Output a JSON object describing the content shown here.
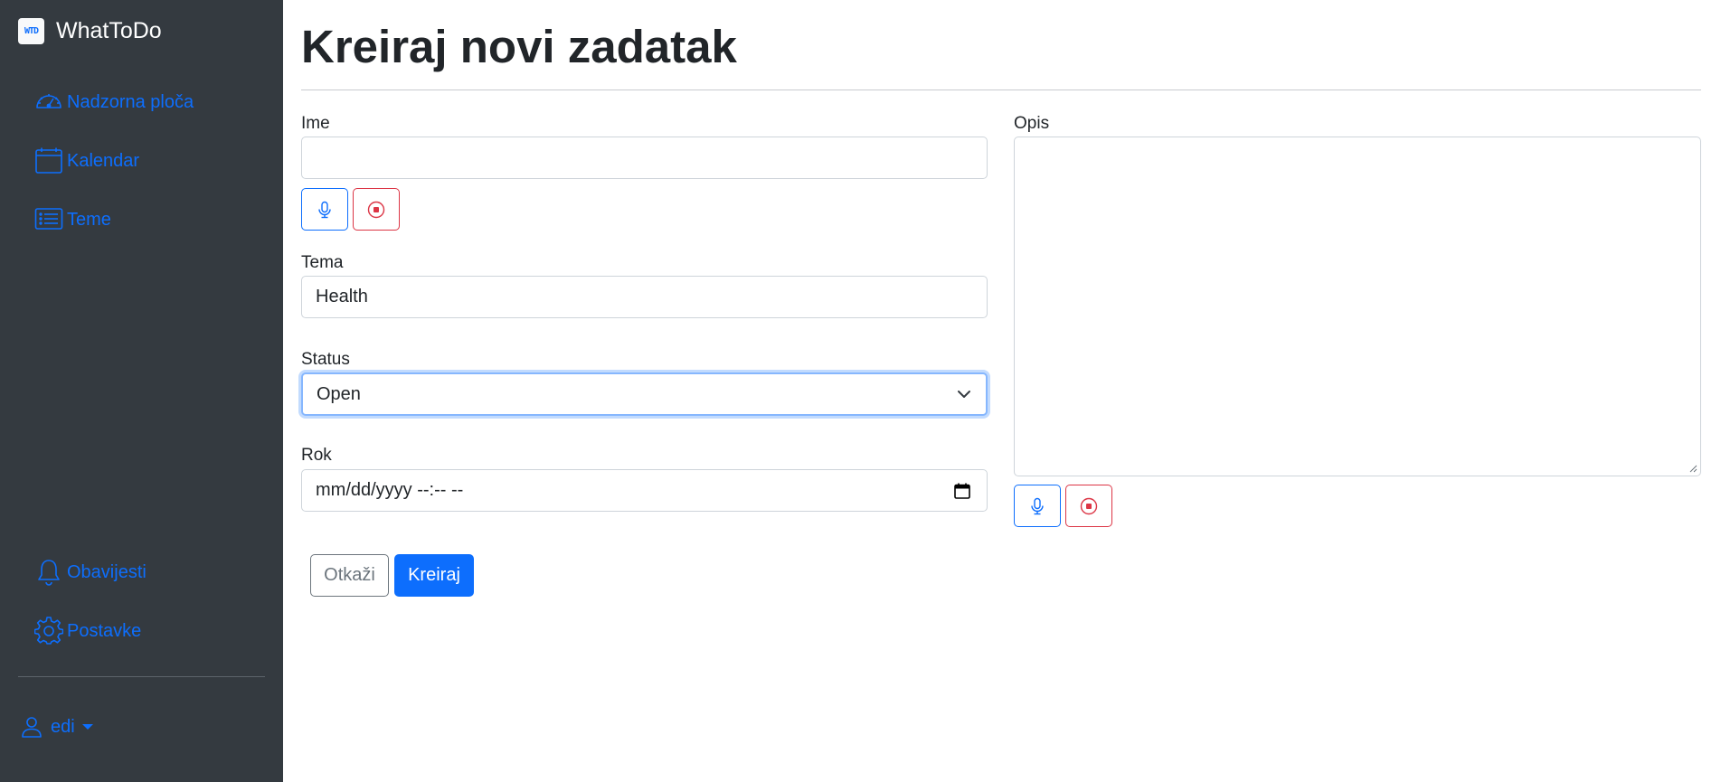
{
  "app": {
    "name": "WhatToDo",
    "logo_text": "WTD"
  },
  "sidebar": {
    "items": [
      {
        "label": "Nadzorna ploča",
        "icon": "speedometer-icon"
      },
      {
        "label": "Kalendar",
        "icon": "calendar-icon"
      },
      {
        "label": "Teme",
        "icon": "list-icon"
      }
    ],
    "bottom_items": [
      {
        "label": "Obavijesti",
        "icon": "bell-icon"
      },
      {
        "label": "Postavke",
        "icon": "gear-icon"
      }
    ],
    "user": {
      "name": "edi",
      "icon": "person-icon"
    }
  },
  "page": {
    "title": "Kreiraj novi zadatak"
  },
  "form": {
    "name": {
      "label": "Ime",
      "value": ""
    },
    "topic": {
      "label": "Tema",
      "value": "Health"
    },
    "status": {
      "label": "Status",
      "selected": "Open"
    },
    "deadline": {
      "label": "Rok",
      "placeholder": "mm/dd/yyyy --:-- --"
    },
    "description": {
      "label": "Opis",
      "value": ""
    },
    "buttons": {
      "cancel": "Otkaži",
      "create": "Kreiraj"
    }
  },
  "colors": {
    "sidebar_bg": "#343a40",
    "primary": "#0d6efd",
    "danger": "#dc3545",
    "secondary": "#6c757d"
  }
}
